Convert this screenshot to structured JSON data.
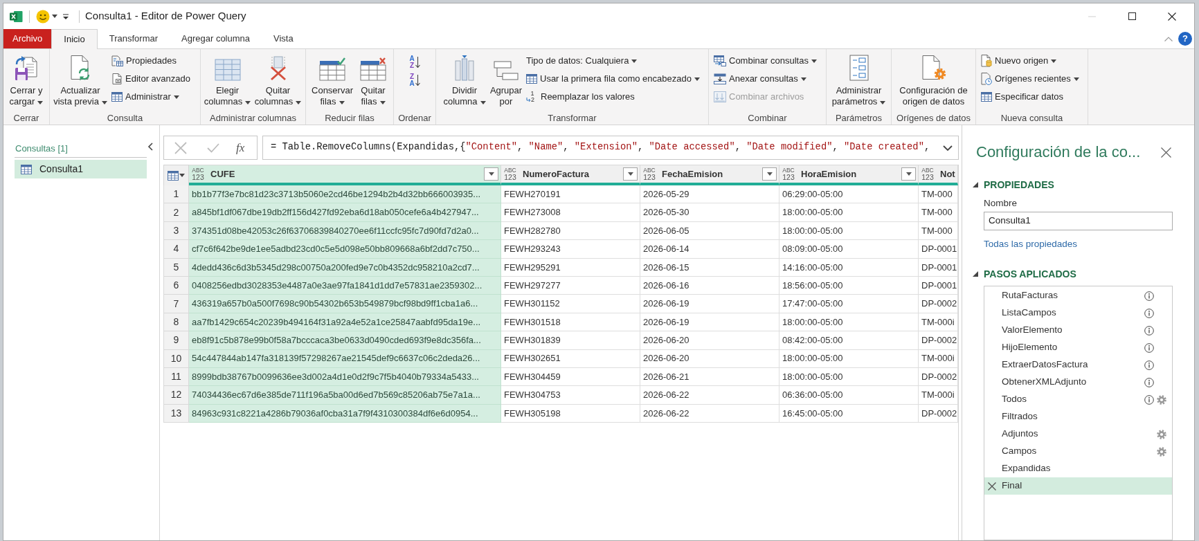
{
  "window": {
    "title": "Consulta1 - Editor de Power Query"
  },
  "tabs": [
    {
      "label": "Archivo",
      "kind": "file",
      "selected": false
    },
    {
      "label": "Inicio",
      "kind": "tab",
      "selected": true
    },
    {
      "label": "Transformar",
      "kind": "tab",
      "selected": false
    },
    {
      "label": "Agregar columna",
      "kind": "tab",
      "selected": false
    },
    {
      "label": "Vista",
      "kind": "tab",
      "selected": false
    }
  ],
  "help": "?",
  "ribbon": [
    {
      "label": "Cerrar",
      "items": [
        {
          "kind": "large",
          "label": "Cerrar y cargar",
          "dropdown": true
        }
      ]
    },
    {
      "label": "Consulta",
      "items": [
        {
          "kind": "large",
          "label": "Actualizar vista previa",
          "dropdown": true
        },
        {
          "kind": "small",
          "label": "Propiedades",
          "dropdown": false
        },
        {
          "kind": "small",
          "label": "Editor avanzado",
          "dropdown": false
        },
        {
          "kind": "small",
          "label": "Administrar",
          "dropdown": true
        }
      ]
    },
    {
      "label": "Administrar columnas",
      "items": [
        {
          "kind": "large",
          "label": "Elegir columnas",
          "dropdown": true
        },
        {
          "kind": "large",
          "label": "Quitar columnas",
          "dropdown": true
        }
      ]
    },
    {
      "label": "Reducir filas",
      "items": [
        {
          "kind": "large",
          "label": "Conservar filas",
          "dropdown": true
        },
        {
          "kind": "large",
          "label": "Quitar filas",
          "dropdown": true
        }
      ]
    },
    {
      "label": "Ordenar",
      "items": [
        {
          "kind": "sort",
          "letters": [
            "A",
            "Z"
          ]
        },
        {
          "kind": "sort",
          "letters": [
            "Z",
            "A"
          ]
        }
      ]
    },
    {
      "label": "Transformar",
      "items": [
        {
          "kind": "large",
          "label": "Dividir columna",
          "dropdown": true
        },
        {
          "kind": "large",
          "label": "Agrupar por",
          "dropdown": false
        },
        {
          "kind": "small",
          "label": "Tipo de datos: Cualquiera",
          "dropdown": true
        },
        {
          "kind": "small",
          "label": "Usar la primera fila como encabezado",
          "dropdown": true
        },
        {
          "kind": "small",
          "label": "Reemplazar los valores",
          "dropdown": false,
          "marks": [
            "1",
            "2"
          ]
        }
      ]
    },
    {
      "label": "Combinar",
      "items": [
        {
          "kind": "small",
          "label": "Combinar consultas",
          "dropdown": true,
          "disabled": false
        },
        {
          "kind": "small",
          "label": "Anexar consultas",
          "dropdown": true,
          "disabled": false
        },
        {
          "kind": "small",
          "label": "Combinar archivos",
          "dropdown": false,
          "disabled": true
        }
      ]
    },
    {
      "label": "Parámetros",
      "items": [
        {
          "kind": "large",
          "label": "Administrar parámetros",
          "dropdown": true
        }
      ]
    },
    {
      "label": "Orígenes de datos",
      "items": [
        {
          "kind": "large",
          "label": "Configuración de origen de datos",
          "dropdown": false
        }
      ]
    },
    {
      "label": "Nueva consulta",
      "items": [
        {
          "kind": "small",
          "label": "Nuevo origen",
          "dropdown": true
        },
        {
          "kind": "small",
          "label": "Orígenes recientes",
          "dropdown": true
        },
        {
          "kind": "small",
          "label": "Especificar datos",
          "dropdown": false
        }
      ]
    }
  ],
  "queries": {
    "heading": "Consultas [1]",
    "items": [
      {
        "label": "Consulta1",
        "selected": true
      }
    ]
  },
  "formula_bar": {
    "function_label": "fx",
    "formula": "= Table.RemoveColumns(Expandidas,{\"Content\", \"Name\", \"Extension\", \"Date accessed\", \"Date modified\", \"Date created\","
  },
  "table": {
    "columns": [
      {
        "name": "CUFE",
        "type": [
          "ABC",
          "123"
        ],
        "selected": true
      },
      {
        "name": "NumeroFactura",
        "type": [
          "ABC",
          "123"
        ],
        "selected": false
      },
      {
        "name": "FechaEmision",
        "type": [
          "ABC",
          "123"
        ],
        "selected": false
      },
      {
        "name": "HoraEmision",
        "type": [
          "ABC",
          "123"
        ],
        "selected": false
      },
      {
        "name": "Not",
        "type": [
          "ABC",
          "123"
        ],
        "selected": false
      }
    ],
    "rows": [
      {
        "number": "1",
        "cells": [
          "bb1b77f3e7bc81d23c3713b5060e2cd46be1294b2b4d32bb666003935...",
          "FEWH270191",
          "2026-05-29",
          "06:29:00-05:00",
          "TM-000"
        ]
      },
      {
        "number": "2",
        "cells": [
          "a845bf1df067dbe19db2ff156d427fd92eba6d18ab050cefe6a4b427947...",
          "FEWH273008",
          "2026-05-30",
          "18:00:00-05:00",
          "TM-000"
        ]
      },
      {
        "number": "3",
        "cells": [
          "374351d08be42053c26f63706839840270ee6f11ccfc95fc7d90fd7d2a0...",
          "FEWH282780",
          "2026-06-05",
          "18:00:00-05:00",
          "TM-000"
        ]
      },
      {
        "number": "4",
        "cells": [
          "cf7c6f642be9de1ee5adbd23cd0c5e5d098e50bb809668a6bf2dd7c750...",
          "FEWH293243",
          "2026-06-14",
          "08:09:00-05:00",
          "DP-0001"
        ]
      },
      {
        "number": "5",
        "cells": [
          "4dedd436c6d3b5345d298c00750a200fed9e7c0b4352dc958210a2cd7...",
          "FEWH295291",
          "2026-06-15",
          "14:16:00-05:00",
          "DP-0001"
        ]
      },
      {
        "number": "6",
        "cells": [
          "0408256edbd3028353e4487a0e3ae97fa1841d1dd7e57831ae2359302...",
          "FEWH297277",
          "2026-06-16",
          "18:56:00-05:00",
          "DP-0001"
        ]
      },
      {
        "number": "7",
        "cells": [
          "436319a657b0a500f7698c90b54302b653b549879bcf98bd9ff1cba1a6...",
          "FEWH301152",
          "2026-06-19",
          "17:47:00-05:00",
          "DP-0002"
        ]
      },
      {
        "number": "8",
        "cells": [
          "aa7fb1429c654c20239b494164f31a92a4e52a1ce25847aabfd95da19e...",
          "FEWH301518",
          "2026-06-19",
          "18:00:00-05:00",
          "TM-000i"
        ]
      },
      {
        "number": "9",
        "cells": [
          "eb8f91c5b878e99b0f58a7bcccaca3be0633d0490cded693f9e8dc356fa...",
          "FEWH301839",
          "2026-06-20",
          "08:42:00-05:00",
          "DP-0002"
        ]
      },
      {
        "number": "10",
        "cells": [
          "54c447844ab147fa318139f57298267ae21545def9c6637c06c2deda26...",
          "FEWH302651",
          "2026-06-20",
          "18:00:00-05:00",
          "TM-000i"
        ]
      },
      {
        "number": "11",
        "cells": [
          "8999bdb38767b0099636ee3d002a4d1e0d2f9c7f5b4040b79334a5433...",
          "FEWH304459",
          "2026-06-21",
          "18:00:00-05:00",
          "DP-0002"
        ]
      },
      {
        "number": "12",
        "cells": [
          "74034436ec67d6e385de711f196a5ba00d6ed7b569c85206ab75e7a1a...",
          "FEWH304753",
          "2026-06-22",
          "06:36:00-05:00",
          "TM-000i"
        ]
      },
      {
        "number": "13",
        "cells": [
          "84963c931c8221a4286b79036af0cba31a7f9f4310300384df6e6d0954...",
          "FEWH305198",
          "2026-06-22",
          "16:45:00-05:00",
          "DP-0002"
        ]
      }
    ]
  },
  "query_settings": {
    "title": "Configuración de la co...",
    "properties": {
      "heading": "PROPIEDADES",
      "expanded": true,
      "name_label": "Nombre",
      "name_value": "Consulta1",
      "link": "Todas las propiedades"
    },
    "applied_steps": {
      "heading": "PASOS APLICADOS",
      "expanded": true,
      "steps": [
        {
          "label": "RutaFacturas",
          "info": true,
          "settings": false,
          "selected": false
        },
        {
          "label": "ListaCampos",
          "info": true,
          "settings": false,
          "selected": false
        },
        {
          "label": "ValorElemento",
          "info": true,
          "settings": false,
          "selected": false
        },
        {
          "label": "HijoElemento",
          "info": true,
          "settings": false,
          "selected": false
        },
        {
          "label": "ExtraerDatosFactura",
          "info": true,
          "settings": false,
          "selected": false
        },
        {
          "label": "ObtenerXMLAdjunto",
          "info": true,
          "settings": false,
          "selected": false
        },
        {
          "label": "Todos",
          "info": true,
          "settings": true,
          "selected": false
        },
        {
          "label": "Filtrados",
          "info": false,
          "settings": false,
          "selected": false
        },
        {
          "label": "Adjuntos",
          "info": false,
          "settings": true,
          "selected": false
        },
        {
          "label": "Campos",
          "info": false,
          "settings": true,
          "selected": false
        },
        {
          "label": "Expandidas",
          "info": false,
          "settings": false,
          "selected": false
        },
        {
          "label": "Final",
          "info": false,
          "settings": false,
          "selected": true
        }
      ]
    }
  }
}
